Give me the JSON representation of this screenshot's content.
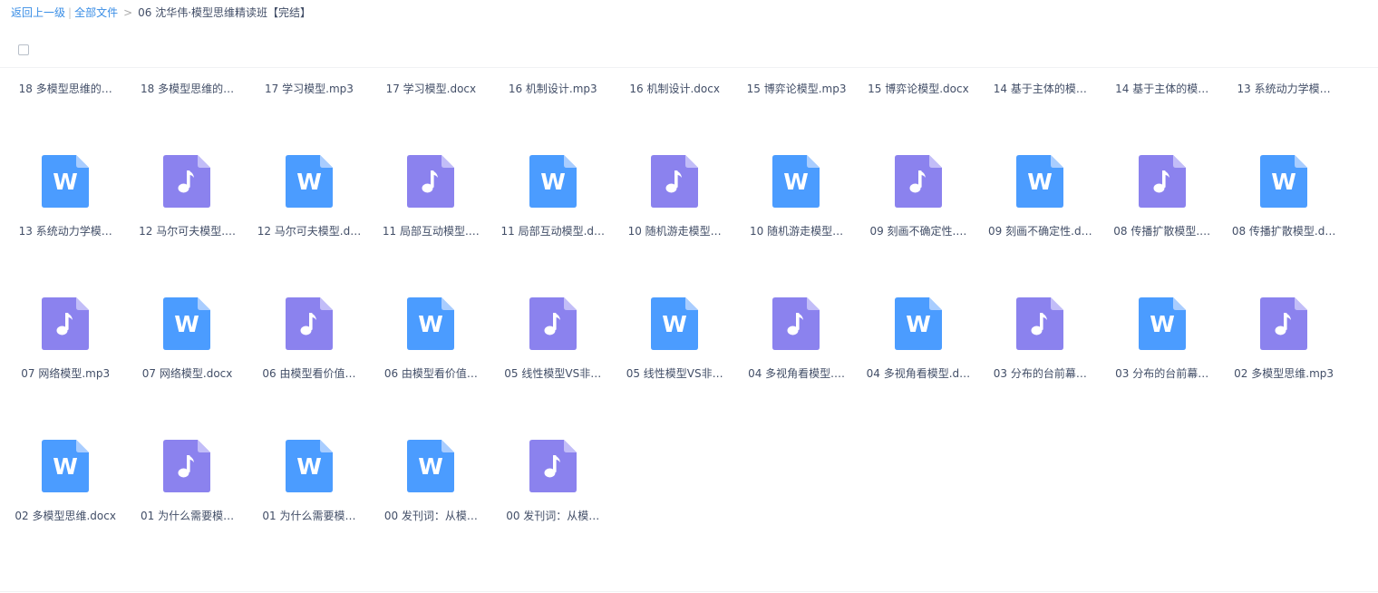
{
  "breadcrumb": {
    "back": "返回上一级",
    "separator": "|",
    "all_files": "全部文件",
    "arrow": ">",
    "current": "06 沈华伟·模型思维精读班【完结】"
  },
  "colors": {
    "link": "#3a8ee6",
    "audio_icon": "#8b82ee",
    "doc_icon": "#4b9cff",
    "text": "#424e67"
  },
  "files": [
    {
      "name": "18 多模型思维的…",
      "type": "audio-file-icon"
    },
    {
      "name": "18 多模型思维的…",
      "type": "word-file-icon"
    },
    {
      "name": "17 学习模型.mp3",
      "type": "audio-file-icon"
    },
    {
      "name": "17 学习模型.docx",
      "type": "word-file-icon"
    },
    {
      "name": "16 机制设计.mp3",
      "type": "audio-file-icon"
    },
    {
      "name": "16 机制设计.docx",
      "type": "word-file-icon"
    },
    {
      "name": "15 博弈论模型.mp3",
      "type": "audio-file-icon"
    },
    {
      "name": "15 博弈论模型.docx",
      "type": "word-file-icon"
    },
    {
      "name": "14 基于主体的模…",
      "type": "audio-file-icon"
    },
    {
      "name": "14 基于主体的模…",
      "type": "word-file-icon"
    },
    {
      "name": "13 系统动力学模…",
      "type": "audio-file-icon"
    },
    {
      "name": "13 系统动力学模…",
      "type": "word-file-icon"
    },
    {
      "name": "12 马尔可夫模型.…",
      "type": "audio-file-icon"
    },
    {
      "name": "12 马尔可夫模型.d…",
      "type": "word-file-icon"
    },
    {
      "name": "11 局部互动模型.…",
      "type": "audio-file-icon"
    },
    {
      "name": "11 局部互动模型.d…",
      "type": "word-file-icon"
    },
    {
      "name": "10 随机游走模型…",
      "type": "audio-file-icon"
    },
    {
      "name": "10 随机游走模型…",
      "type": "word-file-icon"
    },
    {
      "name": "09 刻画不确定性.…",
      "type": "audio-file-icon"
    },
    {
      "name": "09 刻画不确定性.d…",
      "type": "word-file-icon"
    },
    {
      "name": "08 传播扩散模型.…",
      "type": "audio-file-icon"
    },
    {
      "name": "08 传播扩散模型.d…",
      "type": "word-file-icon"
    },
    {
      "name": "07 网络模型.mp3",
      "type": "audio-file-icon"
    },
    {
      "name": "07 网络模型.docx",
      "type": "word-file-icon"
    },
    {
      "name": "06 由模型看价值…",
      "type": "audio-file-icon"
    },
    {
      "name": "06 由模型看价值…",
      "type": "word-file-icon"
    },
    {
      "name": "05 线性模型VS非…",
      "type": "audio-file-icon"
    },
    {
      "name": "05 线性模型VS非…",
      "type": "word-file-icon"
    },
    {
      "name": "04 多视角看模型.…",
      "type": "audio-file-icon"
    },
    {
      "name": "04 多视角看模型.d…",
      "type": "word-file-icon"
    },
    {
      "name": "03 分布的台前幕…",
      "type": "audio-file-icon"
    },
    {
      "name": "03 分布的台前幕…",
      "type": "word-file-icon"
    },
    {
      "name": "02 多模型思维.mp3",
      "type": "audio-file-icon"
    },
    {
      "name": "02 多模型思维.docx",
      "type": "word-file-icon"
    },
    {
      "name": "01 为什么需要模…",
      "type": "audio-file-icon"
    },
    {
      "name": "01 为什么需要模…",
      "type": "word-file-icon"
    },
    {
      "name": "00 发刊词：从模…",
      "type": "word-file-icon"
    },
    {
      "name": "00 发刊词：从模…",
      "type": "audio-file-icon"
    }
  ]
}
